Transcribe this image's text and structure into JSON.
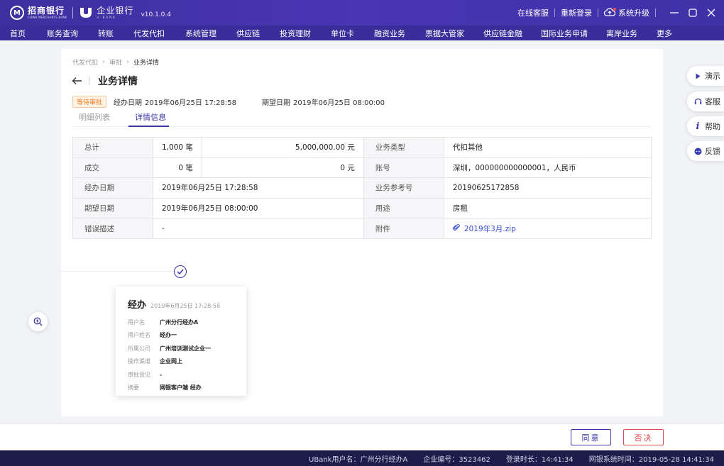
{
  "titlebar": {
    "bank_logo_cn": "招商银行",
    "bank_logo_en": "CHINA MERCHANTS BANK",
    "ent_logo_cn": "企业银行",
    "ent_logo_en": "U·BANK",
    "version": "v10.1.0.4",
    "online_service": "在线客服",
    "relogin": "重新登录",
    "upgrade": "系统升级"
  },
  "nav": {
    "items": [
      "首页",
      "账务查询",
      "转账",
      "代发代扣",
      "系统管理",
      "供应链",
      "投资理财",
      "单位卡",
      "融资业务",
      "票据大管家",
      "供应链金融",
      "国际业务申请",
      "离岸业务",
      "更多"
    ]
  },
  "float_menu": {
    "demo": "演示",
    "service": "客服",
    "help": "帮助",
    "feedback": "反馈"
  },
  "breadcrumb": {
    "l1": "代发代扣",
    "l2": "审批",
    "l3": "业务详情"
  },
  "page": {
    "title": "业务详情",
    "status": "等待审批",
    "handle_date_label": "经办日期",
    "handle_date": "2019年06月25日 17:28:58",
    "expect_date_label": "期望日期",
    "expect_date": "2019年06月25日 08:00:00"
  },
  "tabs": {
    "list": "明细列表",
    "detail": "详情信息"
  },
  "table": {
    "total_label": "总计",
    "total_count": "1,000 笔",
    "total_amount": "5,000,000.00 元",
    "biz_type_label": "业务类型",
    "biz_type": "代扣其他",
    "done_label": "成交",
    "done_count": "0 笔",
    "done_amount": "0 元",
    "account_label": "账号",
    "account": "深圳，000000000000001，人民币",
    "handle_date_label": "经办日期",
    "handle_date": "2019年06月25日 17:28:58",
    "ref_label": "业务参考号",
    "ref": "20190625172858",
    "expect_date_label": "期望日期",
    "expect_date": "2019年06月25日 08:00:00",
    "purpose_label": "用途",
    "purpose": "房租",
    "error_label": "错误描述",
    "error": "-",
    "attachment_label": "附件",
    "attachment": "2019年3月.zip"
  },
  "flow": {
    "title": "经办",
    "time": "2019年6月25日 17:28:58",
    "rows": [
      {
        "label": "用户名",
        "value": "广州分行经办A"
      },
      {
        "label": "用户姓名",
        "value": "经办一"
      },
      {
        "label": "所属公司",
        "value": "广州培训测试企业一"
      },
      {
        "label": "操作渠道",
        "value": "企业网上"
      },
      {
        "label": "审批意见",
        "value": "-"
      },
      {
        "label": "摘要",
        "value": "网银客户端 经办"
      }
    ]
  },
  "actions": {
    "agree": "同意",
    "reject": "否决"
  },
  "statusbar": {
    "user": "UBank用户名：广州分行经办A",
    "corp": "企业编号：3523462",
    "login": "登录时长：14:41:34",
    "systime": "网银系统时间：2019-05-28 14:41:34"
  },
  "colors": {
    "brand": "#3f31a6",
    "accent": "#3a34a8",
    "danger": "#e24b4b",
    "pending": "#f07d22"
  }
}
